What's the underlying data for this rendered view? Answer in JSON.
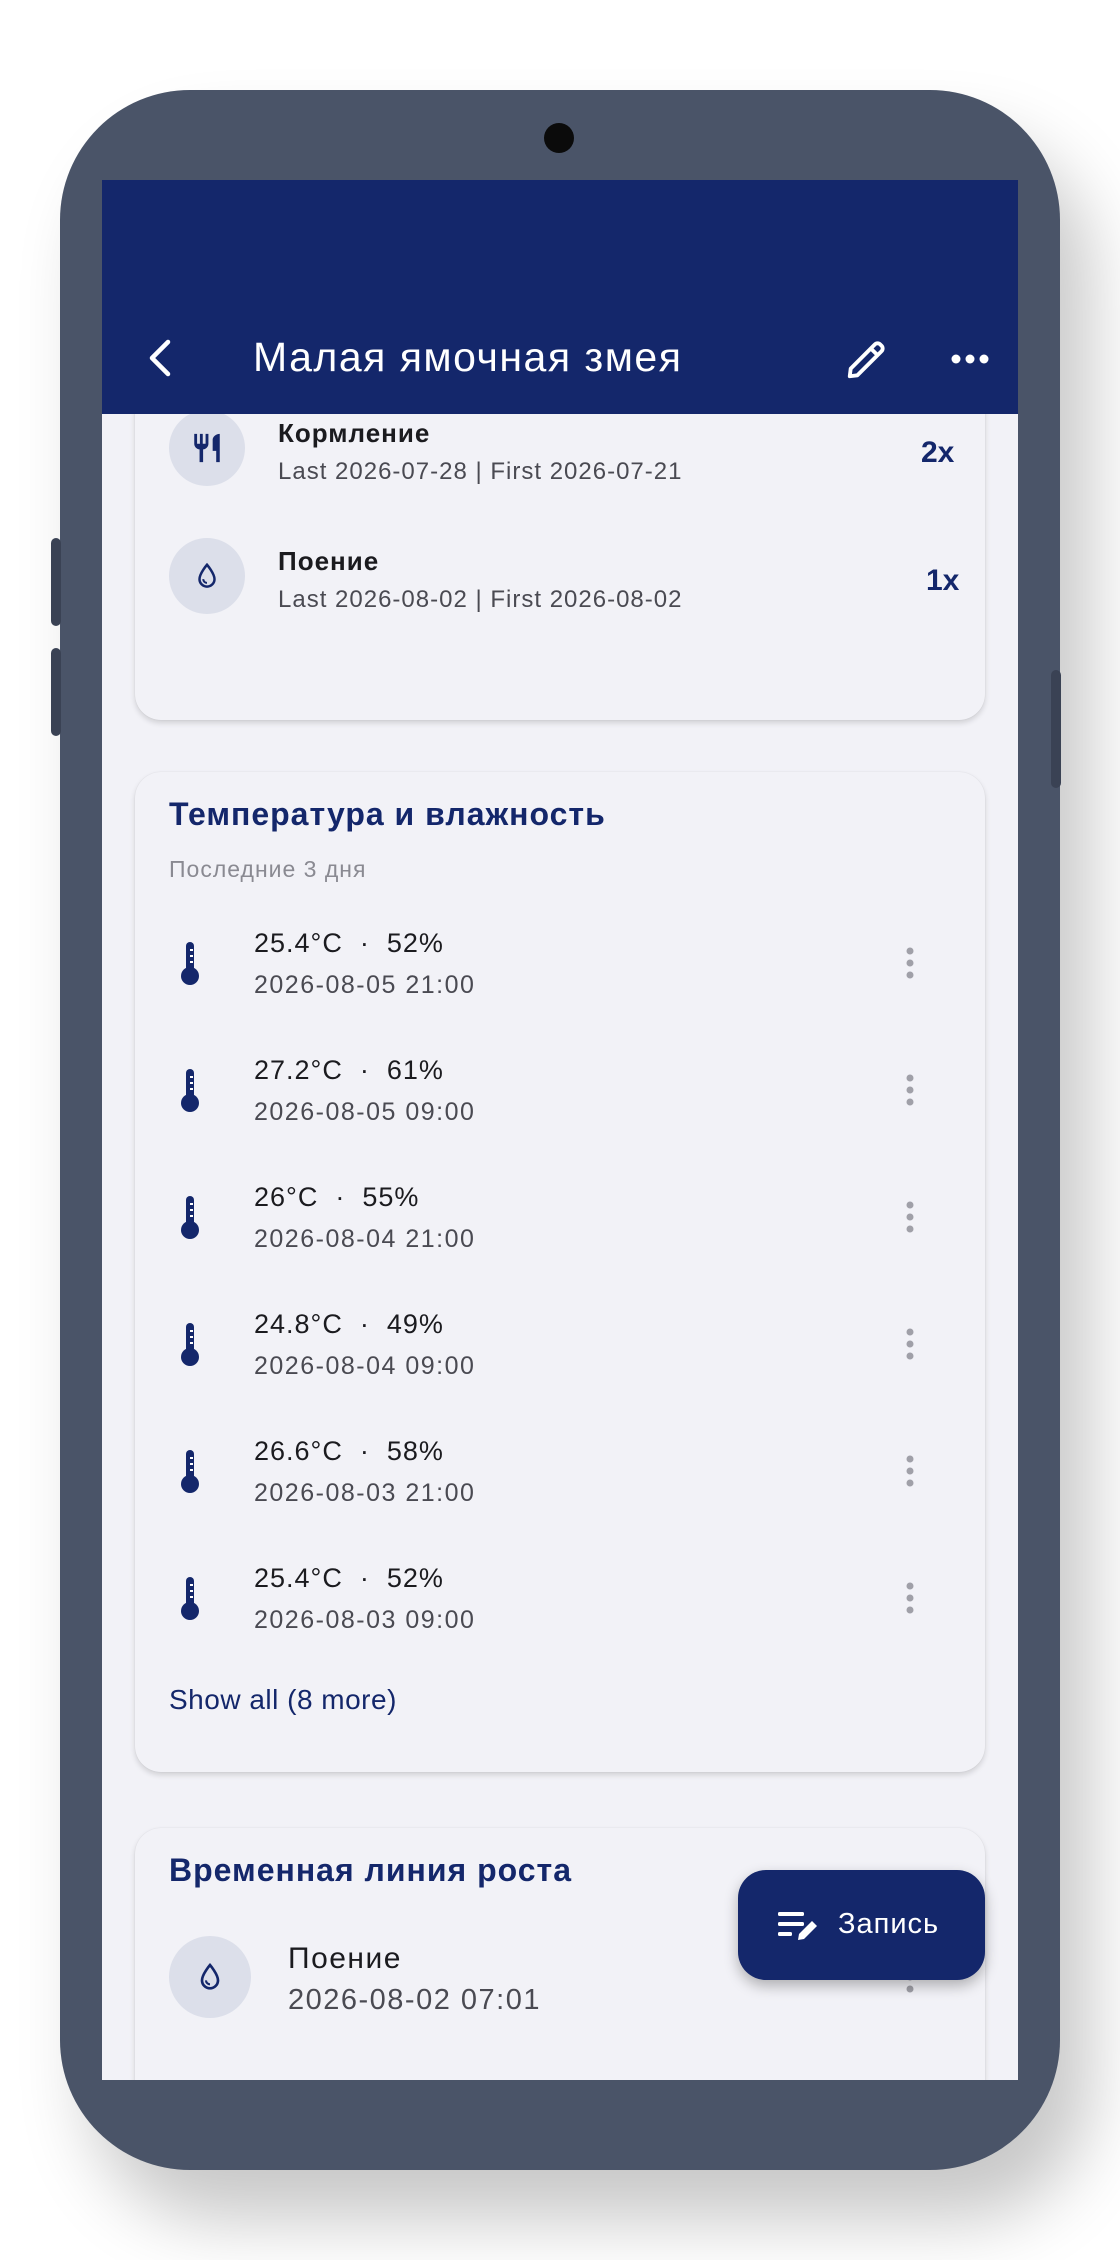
{
  "appbar": {
    "title": "Малая ямочная змея",
    "back_icon": "back-arrow-icon",
    "edit_icon": "pencil-icon",
    "more_icon": "more-horizontal-icon"
  },
  "summary": {
    "items": [
      {
        "title": "Кормление",
        "subtitle": "Last 2026-07-28 | First 2026-07-21",
        "count": "2x",
        "icon": "fork-knife-icon"
      },
      {
        "title": "Поение",
        "subtitle": "Last 2026-08-02 | First 2026-08-02",
        "count": "1x",
        "icon": "water-drop-icon"
      }
    ]
  },
  "climate": {
    "title": "Температура и влажность",
    "subtitle": "Последние 3 дня",
    "readings": [
      {
        "temp": "25.4°C",
        "humidity": "52%",
        "time": "2026-08-05 21:00"
      },
      {
        "temp": "27.2°C",
        "humidity": "61%",
        "time": "2026-08-05 09:00"
      },
      {
        "temp": "26°C",
        "humidity": "55%",
        "time": "2026-08-04 21:00"
      },
      {
        "temp": "24.8°C",
        "humidity": "49%",
        "time": "2026-08-04 09:00"
      },
      {
        "temp": "26.6°C",
        "humidity": "58%",
        "time": "2026-08-03 21:00"
      },
      {
        "temp": "25.4°C",
        "humidity": "52%",
        "time": "2026-08-03 09:00"
      }
    ],
    "separator": "·",
    "show_all": "Show all (8 more)"
  },
  "growth": {
    "title": "Временная линия роста",
    "items": [
      {
        "title": "Поение",
        "time": "2026-08-02 07:01",
        "icon": "water-drop-icon"
      }
    ]
  },
  "fab": {
    "label": "Запись",
    "icon": "note-edit-icon"
  },
  "colors": {
    "primary": "#14276b",
    "background": "#f2f2f7",
    "phone_frame": "#4a5468",
    "icon_circle": "#dcdfea"
  }
}
